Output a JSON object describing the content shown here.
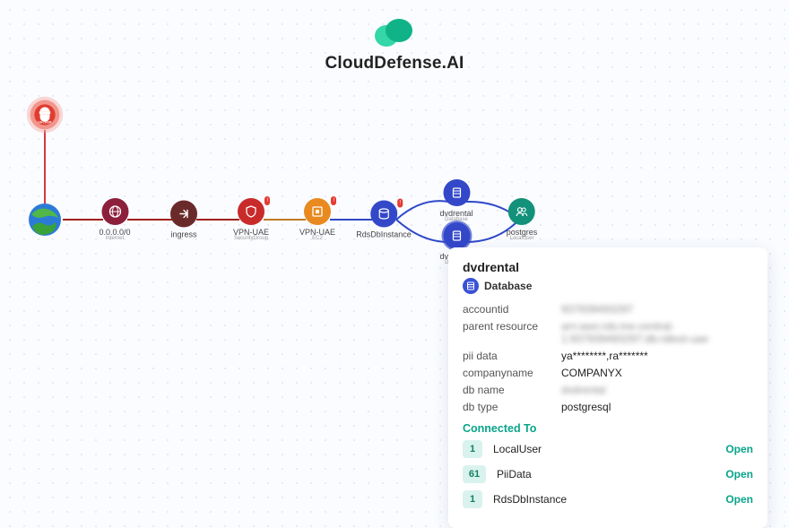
{
  "brand": "CloudDefense.AI",
  "nodes": {
    "hacker": {
      "label": "HACKER"
    },
    "internet": {
      "label": "0.0.0.0/0",
      "sublabel": "Internet"
    },
    "ingress": {
      "label": "ingress",
      "sublabel": ""
    },
    "sg": {
      "label": "VPN-UAE",
      "sublabel": "SecurityGroup"
    },
    "ec2": {
      "label": "VPN-UAE",
      "sublabel": "EC2"
    },
    "rds": {
      "label": "RdsDbInstance",
      "sublabel": ""
    },
    "db_top": {
      "label": "dvdrental",
      "sublabel": "Database"
    },
    "db_bot": {
      "label": "dvdrental",
      "sublabel": "Database"
    },
    "user": {
      "label": "postgres",
      "sublabel": "LocalUser"
    }
  },
  "panel": {
    "title": "dvdrental",
    "type_label": "Database",
    "rows": {
      "accountid_k": "accountid",
      "accountid_v": "937939493297",
      "parent_k": "parent resource",
      "parent_v": "arn:aws:rds:me-central-1:937939493297:db:rdtest-uae",
      "pii_k": "pii data",
      "pii_v": "ya********,ra*******",
      "company_k": "companyname",
      "company_v": "COMPANYX",
      "dbname_k": "db name",
      "dbname_v": "dvdrental",
      "dbtype_k": "db type",
      "dbtype_v": "postgresql"
    },
    "connected_header": "Connected To",
    "connected": [
      {
        "count": "1",
        "type": "LocalUser",
        "action": "Open"
      },
      {
        "count": "61",
        "type": "PiiData",
        "action": "Open"
      },
      {
        "count": "1",
        "type": "RdsDbInstance",
        "action": "Open"
      }
    ]
  }
}
